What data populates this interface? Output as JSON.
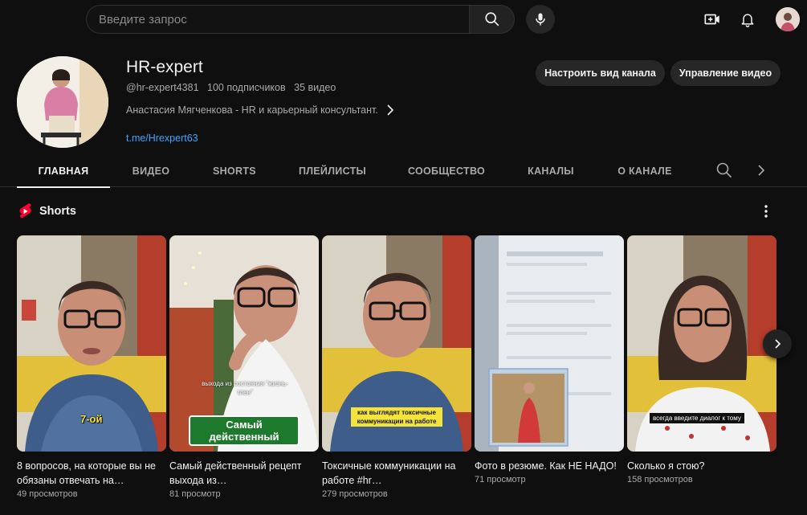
{
  "search": {
    "placeholder": "Введите запрос"
  },
  "channel": {
    "title": "HR-expert",
    "handle": "@hr-expert4381",
    "subscribers": "100 подписчиков",
    "videos": "35 видео",
    "description": "Анастасия Мягченкова - HR и карьерный консультант.",
    "link": "t.me/Hrexpert63",
    "customize_label": "Настроить вид канала",
    "manage_label": "Управление видео"
  },
  "tabs": [
    {
      "label": "ГЛАВНАЯ"
    },
    {
      "label": "ВИДЕО"
    },
    {
      "label": "SHORTS"
    },
    {
      "label": "ПЛЕЙЛИСТЫ"
    },
    {
      "label": "СООБЩЕСТВО"
    },
    {
      "label": "КАНАЛЫ"
    },
    {
      "label": "О КАНАЛЕ"
    }
  ],
  "shorts": {
    "section_title": "Shorts",
    "items": [
      {
        "title": "8 вопросов, на которые вы не обязаны отвечать на…",
        "views": "49 просмотров",
        "overlay": "7-ой"
      },
      {
        "title": "Самый действенный рецепт выхода из…",
        "views": "81 просмотр",
        "overlay_small": "выхода из состояния \"жизнь-тлен\"",
        "overlay": "Самый действенный"
      },
      {
        "title": "Токсичные коммуникации на работе #hr…",
        "views": "279 просмотров",
        "overlay": "как выглядят токсичные коммуникации на работе"
      },
      {
        "title": "Фото в резюме. Как НЕ НАДО!",
        "views": "71 просмотр"
      },
      {
        "title": "Сколько я стою?",
        "views": "158 просмотров",
        "overlay": "всегда введите диалог к тому"
      }
    ]
  },
  "colors": {
    "background": "#0f0f0f",
    "link": "#3ea6ff",
    "shorts_red": "#ff0033",
    "button_bg": "#272727"
  },
  "icons": [
    "search-icon",
    "mic-icon",
    "create-icon",
    "bell-icon",
    "chevron-right-icon",
    "shorts-logo-icon",
    "more-vert-icon"
  ]
}
